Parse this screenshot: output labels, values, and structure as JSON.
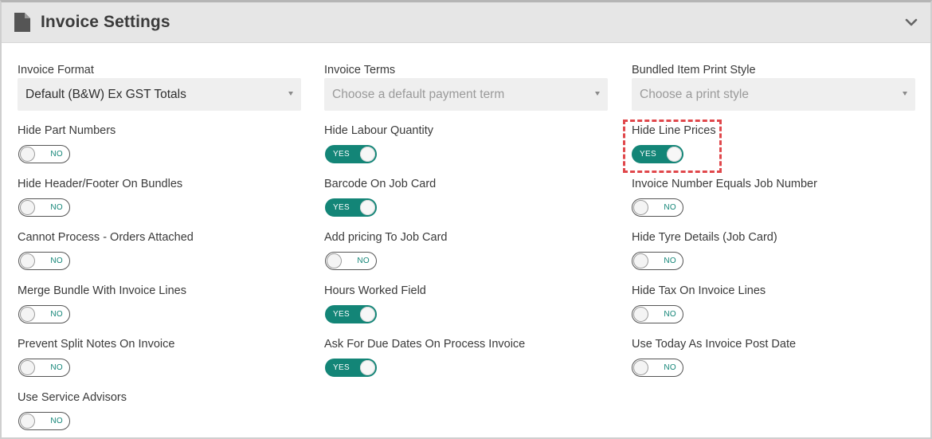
{
  "header": {
    "title": "Invoice Settings",
    "icon": "document-icon",
    "collapse_icon": "chevron-down-icon"
  },
  "selects": {
    "invoice_format": {
      "label": "Invoice Format",
      "value": "Default (B&W) Ex GST Totals",
      "placeholder": ""
    },
    "invoice_terms": {
      "label": "Invoice Terms",
      "value": "",
      "placeholder": "Choose a default payment term"
    },
    "bundled_print_style": {
      "label": "Bundled Item Print Style",
      "value": "",
      "placeholder": "Choose a print style"
    }
  },
  "toggles": {
    "hide_part_numbers": {
      "label": "Hide Part Numbers",
      "state": "NO"
    },
    "hide_labour_quantity": {
      "label": "Hide Labour Quantity",
      "state": "YES"
    },
    "hide_line_prices": {
      "label": "Hide Line Prices",
      "state": "YES"
    },
    "hide_header_footer_bundles": {
      "label": "Hide Header/Footer On Bundles",
      "state": "NO"
    },
    "barcode_on_job_card": {
      "label": "Barcode On Job Card",
      "state": "YES"
    },
    "invoice_number_equals_job_number": {
      "label": "Invoice Number Equals Job Number",
      "state": "NO"
    },
    "cannot_process_orders_attached": {
      "label": "Cannot Process - Orders Attached",
      "state": "NO"
    },
    "add_pricing_to_job_card": {
      "label": "Add pricing To Job Card",
      "state": "NO"
    },
    "hide_tyre_details": {
      "label": "Hide Tyre Details (Job Card)",
      "state": "NO"
    },
    "merge_bundle_with_invoice_lines": {
      "label": "Merge Bundle With Invoice Lines",
      "state": "NO"
    },
    "hours_worked_field": {
      "label": "Hours Worked Field",
      "state": "YES"
    },
    "hide_tax_on_invoice_lines": {
      "label": "Hide Tax On Invoice Lines",
      "state": "NO"
    },
    "prevent_split_notes_on_invoice": {
      "label": "Prevent Split Notes On Invoice",
      "state": "NO"
    },
    "ask_for_due_dates": {
      "label": "Ask For Due Dates On Process Invoice",
      "state": "YES"
    },
    "use_today_as_post_date": {
      "label": "Use Today As Invoice Post Date",
      "state": "NO"
    },
    "use_service_advisors": {
      "label": "Use Service Advisors",
      "state": "NO"
    }
  },
  "colors": {
    "toggle_on": "#138577",
    "highlight": "#e0474b",
    "header_bg": "#e6e6e6"
  }
}
